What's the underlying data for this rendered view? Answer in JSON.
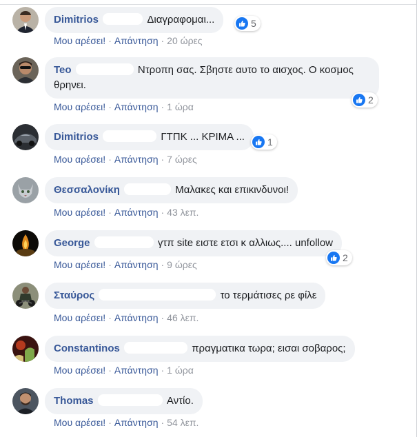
{
  "like_label": "Μου αρέσει!",
  "reply_label": "Απάντηση",
  "separator": "·",
  "colors": {
    "name": "#385898",
    "bubble": "#f0f2f5",
    "like_blue": "#1877f2",
    "meta": "#90949c"
  },
  "comments": [
    {
      "name": "Dimitrios",
      "text": "Διαγραφομαι...",
      "time": "20 ώρες",
      "reactions": "5",
      "avatar": "avatar-man-suit"
    },
    {
      "name": "Teo",
      "text": "Ντροπη σας. Σβηστε αυτο το αισχος. Ο κοσμος θρηνει.",
      "time": "1 ώρα",
      "reactions": "2",
      "avatar": "avatar-man-sunglasses"
    },
    {
      "name": "Dimitrios",
      "text": "ΓΤΠΚ ... ΚΡΙΜΑ ...",
      "time": "7 ώρες",
      "reactions": "1",
      "avatar": "avatar-car"
    },
    {
      "name": "Θεσσαλονίκη",
      "text": "Μαλακες και επικινδυνοι!",
      "time": "43 λεπ.",
      "reactions": "",
      "avatar": "avatar-cat"
    },
    {
      "name": "George",
      "text": "γτπ site ειστε ετσι κ αλλιως.... unfollow",
      "time": "9 ώρες",
      "reactions": "2",
      "avatar": "avatar-candle"
    },
    {
      "name": "Σταύρος",
      "text": "το τερμάτισες ρε φίλε",
      "time": "46 λεπ.",
      "reactions": "",
      "avatar": "avatar-motorbike"
    },
    {
      "name": "Constantinos",
      "text": "πραγματικα τωρα; εισαι σοβαρος;",
      "time": "1 ώρα",
      "reactions": "",
      "avatar": "avatar-red-scene"
    },
    {
      "name": "Thomas",
      "text": "Αντίο.",
      "time": "54 λεπ.",
      "reactions": "",
      "avatar": "avatar-man-portrait"
    }
  ]
}
